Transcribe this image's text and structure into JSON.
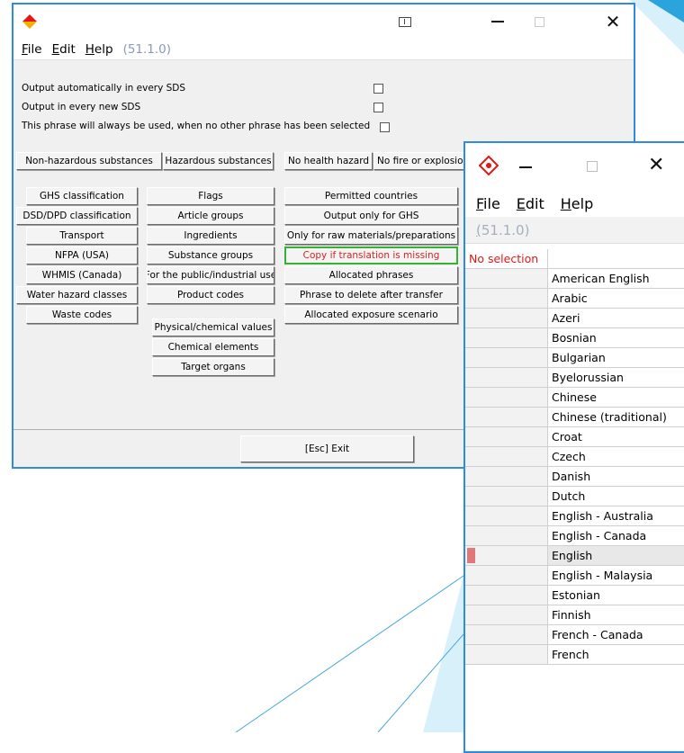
{
  "colors": {
    "window_border": "#2f8ae5",
    "highlight_text": "#e02020",
    "green_border": "#34b234",
    "version_text": "#8a9ab8",
    "selection_marker": "#e07878",
    "bg_shape": "#d7f0fa",
    "bg_shape_dark": "#2ba3dc"
  },
  "main_window": {
    "menu": [
      {
        "label": "File",
        "accel": "F",
        "rest": "ile"
      },
      {
        "label": "Edit",
        "accel": "E",
        "rest": "dit"
      },
      {
        "label": "Help",
        "accel": "H",
        "rest": "elp"
      }
    ],
    "version": "(51.1.0)",
    "options": [
      {
        "label": "Output automatically in every SDS",
        "checked": false
      },
      {
        "label": "Output in every new SDS",
        "checked": false
      },
      {
        "label": "This phrase will always be used, when no other phrase has been selected",
        "checked": false
      }
    ],
    "top_buttons": [
      "Non-hazardous substances",
      "Hazardous substances",
      "No health hazard",
      "No fire or explosion hazard"
    ],
    "col1": [
      "GHS classification",
      "DSD/DPD classification",
      "Transport",
      "NFPA (USA)",
      "WHMIS (Canada)",
      "Water hazard classes",
      "Waste codes"
    ],
    "col2": [
      "Flags",
      "Article groups",
      "Ingredients",
      "Substance groups",
      "For the public/industrial use",
      "Product codes",
      "Physical/chemical values",
      "Chemical elements",
      "Target organs"
    ],
    "col3": [
      "Permitted countries",
      "Output only for GHS",
      "Only for raw materials/preparations",
      "Copy if translation is missing",
      "Allocated phrases",
      "Phrase to delete after transfer",
      "Allocated exposure scenario"
    ],
    "exit_button": "[Esc] Exit"
  },
  "language_window": {
    "menu": [
      {
        "label": "File",
        "accel": "F",
        "rest": "ile"
      },
      {
        "label": "Edit",
        "accel": "E",
        "rest": "dit"
      },
      {
        "label": "Help",
        "accel": "H",
        "rest": "elp"
      }
    ],
    "version_accel": "(",
    "version_rest": "51.1.0)",
    "header_selection": "No selection",
    "languages": [
      "American English",
      "Arabic",
      "Azeri",
      "Bosnian",
      "Bulgarian",
      "Byelorussian",
      "Chinese",
      "Chinese (traditional)",
      "Croat",
      "Czech",
      "Danish",
      "Dutch",
      "English - Australia",
      "English - Canada",
      "English",
      "English - Malaysia",
      "Estonian",
      "Finnish",
      "French - Canada",
      "French"
    ],
    "selected_language": "English"
  }
}
